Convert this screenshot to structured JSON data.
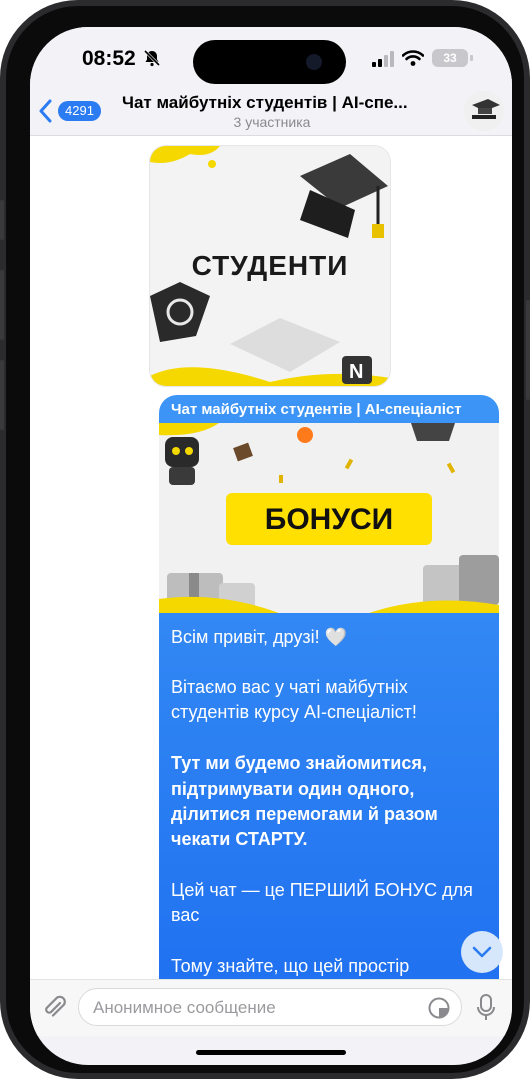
{
  "status_bar": {
    "time": "08:52",
    "battery": "33"
  },
  "header": {
    "back_count": "4291",
    "title": "Чат майбутніх студентів | AI-спе...",
    "subtitle": "3 участника"
  },
  "sticker": {
    "text": "СТУДЕНТИ"
  },
  "message": {
    "forwarded_from": "Чат майбутніх студентів | AI-спеціаліст",
    "banner_text": "БОНУСИ",
    "line1": "Всім привіт, друзі! 🤍",
    "line2": "Вітаємо вас у чаті майбутніх",
    "line3": "студентів курсу AI-спеціаліст!",
    "bold1": "Тут ми будемо знайомитися,",
    "bold2": "підтримувати один одного,",
    "bold3": "ділитися перемогами й разом",
    "bold4": "чекати СТАРТУ.",
    "line4": "Цей чат — це ПЕРШИЙ БОНУС для",
    "line5": "вас",
    "line6": "Тому знайте, що цей простір"
  },
  "input": {
    "placeholder": "Анонимное сообщение"
  },
  "colors": {
    "accent": "#2b7bf2",
    "bubble": "#2a7ef2",
    "banner_yellow": "#ffe000"
  }
}
